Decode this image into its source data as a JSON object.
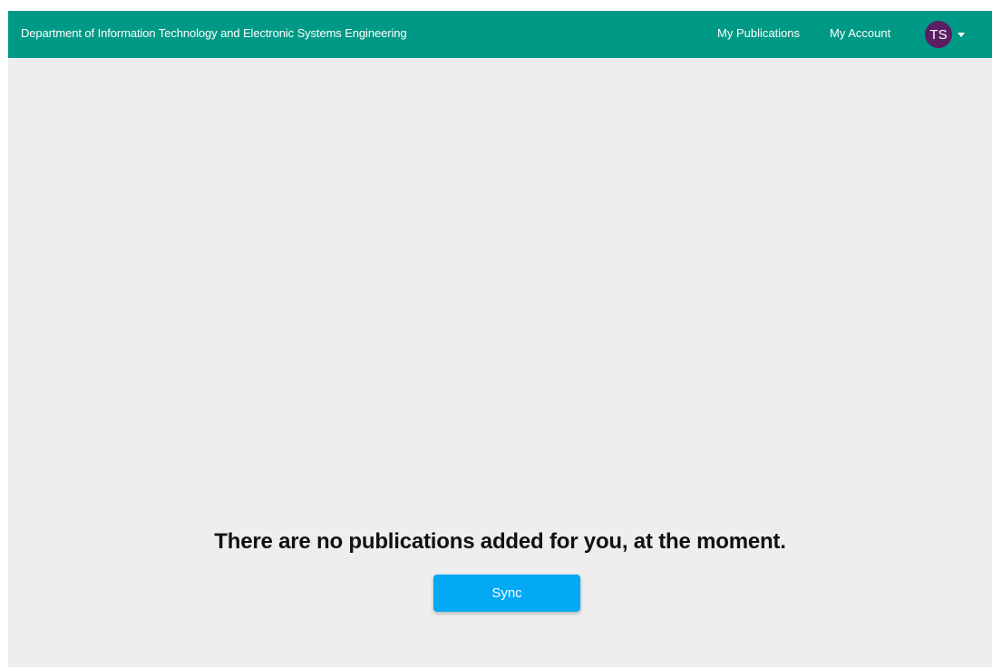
{
  "navbar": {
    "title": "Department of Information Technology and Electronic Systems Engineering",
    "links": {
      "publications": "My Publications",
      "account": "My Account"
    },
    "user": {
      "initials": "TS"
    }
  },
  "main": {
    "empty_message": "There are no publications added for you, at the moment.",
    "sync_label": "Sync"
  },
  "colors": {
    "navbar_bg": "#009985",
    "avatar_bg": "#5a1e63",
    "page_bg": "#eeeeee",
    "button_bg": "#03a9f4"
  },
  "icons": {
    "caret": "caret-down-icon"
  }
}
